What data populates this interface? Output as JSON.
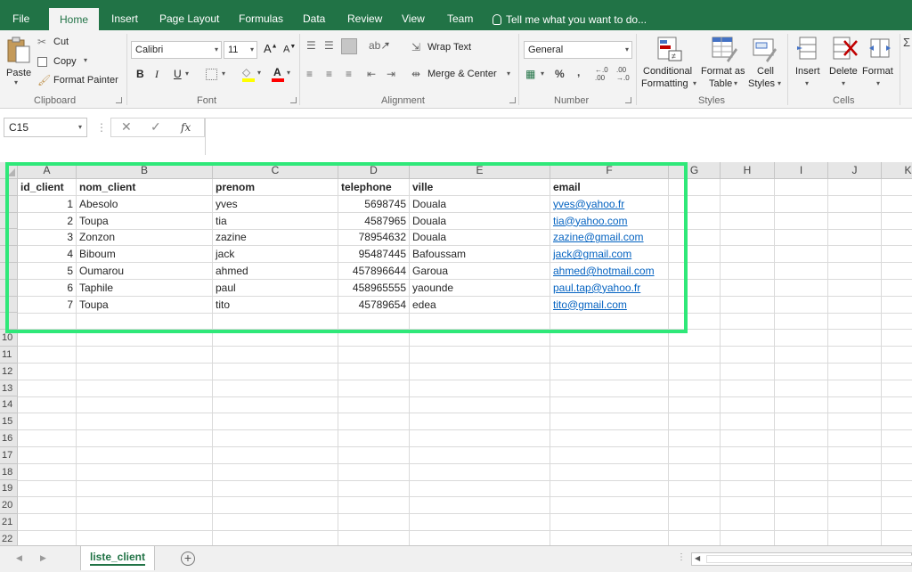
{
  "menu": {
    "tabs": [
      "File",
      "Home",
      "Insert",
      "Page Layout",
      "Formulas",
      "Data",
      "Review",
      "View",
      "Team"
    ],
    "active_tab": "Home",
    "tell_me": "Tell me what you want to do..."
  },
  "ribbon": {
    "clipboard": {
      "paste": "Paste",
      "cut": "Cut",
      "copy": "Copy",
      "format_painter": "Format Painter",
      "label": "Clipboard"
    },
    "font": {
      "name": "Calibri",
      "size": "11",
      "bold": "B",
      "italic": "I",
      "underline": "U",
      "grow": "A",
      "shrink": "A",
      "font_color": "A",
      "label": "Font",
      "fill_color_hex": "#ffff00",
      "font_color_hex": "#ff0000"
    },
    "alignment": {
      "wrap_text": "Wrap Text",
      "merge_center": "Merge & Center",
      "label": "Alignment"
    },
    "number": {
      "format": "General",
      "percent": "%",
      "comma": ",",
      "inc_decimal": "←.0\n.00",
      "label": "Number"
    },
    "styles": {
      "conditional_formatting": [
        "Conditional",
        "Formatting"
      ],
      "format_as_table": [
        "Format as",
        "Table"
      ],
      "cell_styles": [
        "Cell",
        "Styles"
      ],
      "label": "Styles"
    },
    "cells": {
      "insert": "Insert",
      "delete": "Delete",
      "format": "Format",
      "label": "Cells"
    }
  },
  "formula_bar": {
    "name_box": "C15",
    "cancel": "✕",
    "enter": "✓",
    "fx": "fx",
    "value": ""
  },
  "grid": {
    "columns": [
      "A",
      "B",
      "C",
      "D",
      "E",
      "F",
      "G",
      "H",
      "I",
      "J",
      "K"
    ],
    "row_numbers": [
      "10",
      "11",
      "12",
      "13",
      "14",
      "15",
      "16",
      "17",
      "18",
      "19",
      "20",
      "21",
      "22"
    ],
    "headers": [
      "id_client",
      "nom_client",
      "prenom",
      "telephone",
      "ville",
      "email"
    ],
    "rows": [
      [
        "1",
        "Abesolo",
        "yves",
        "5698745",
        "Douala",
        "yves@yahoo.fr"
      ],
      [
        "2",
        "Toupa",
        "tia",
        "4587965",
        "Douala",
        "tia@yahoo.com"
      ],
      [
        "3",
        "Zonzon",
        "zazine",
        "78954632",
        "Douala",
        "zazine@gmail.com"
      ],
      [
        "4",
        "Biboum",
        "jack",
        "95487445",
        "Bafoussam",
        "jack@gmail.com"
      ],
      [
        "5",
        "Oumarou",
        "ahmed",
        "457896644",
        "Garoua",
        "ahmed@hotmail.com"
      ],
      [
        "6",
        "Taphile",
        "paul",
        "458965555",
        "yaounde",
        "paul.tap@yahoo.fr"
      ],
      [
        "7",
        "Toupa",
        "tito",
        "45789654",
        "edea",
        "tito@gmail.com"
      ]
    ],
    "highlight_color": "#2fe879",
    "link_color": "#0563c1"
  },
  "sheet_tabs": {
    "active": "liste_client",
    "add": "+"
  },
  "colors": {
    "excel_green": "#217346",
    "ribbon_bg": "#f3f3f3"
  }
}
